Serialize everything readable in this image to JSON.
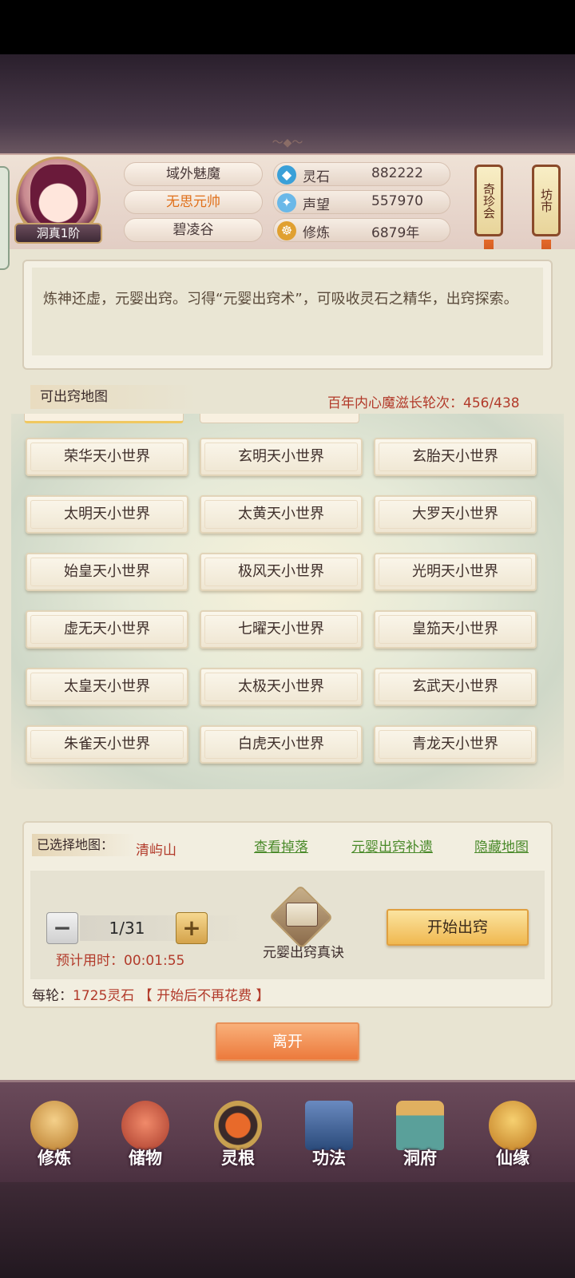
{
  "header": {
    "rank": "洞真1阶",
    "tags": [
      "域外魅魔",
      "无思元帅",
      "碧凌谷"
    ],
    "resources": [
      {
        "icon": "spirit-stone-icon",
        "label": "灵石",
        "value": "882222"
      },
      {
        "icon": "reputation-icon",
        "label": "声望",
        "value": "557970"
      },
      {
        "icon": "cultivation-icon",
        "label": "修炼",
        "value": "6879年"
      }
    ],
    "lanterns": [
      "奇珍会",
      "坊市"
    ]
  },
  "description": "炼神还虚，元婴出窍。习得“元婴出窍术”，可吸收灵石之精华，出窍探索。",
  "maps_section": {
    "title": "可出窍地图",
    "counter": "百年内心魔滋长轮次：456/438",
    "rows": [
      [
        "荣华天小世界",
        "玄明天小世界",
        "玄胎天小世界"
      ],
      [
        "太明天小世界",
        "太黄天小世界",
        "大罗天小世界"
      ],
      [
        "始皇天小世界",
        "极风天小世界",
        "光明天小世界"
      ],
      [
        "虚无天小世界",
        "七曜天小世界",
        "皇笳天小世界"
      ],
      [
        "太皇天小世界",
        "太极天小世界",
        "玄武天小世界"
      ],
      [
        "朱雀天小世界",
        "白虎天小世界",
        "青龙天小世界"
      ]
    ]
  },
  "selection": {
    "label": "已选择地图：",
    "value": "清屿山",
    "links": [
      "查看掉落",
      "元婴出窍补遗",
      "隐藏地图"
    ],
    "stepper": {
      "minus": "−",
      "plus": "+",
      "value": "1/31"
    },
    "eta": "预计用时：00:01:55",
    "item_label": "元婴出窍真诀",
    "start_label": "开始出窍",
    "cost_prefix": "每轮：",
    "cost_value": "1725灵石",
    "cost_note": "【 开始后不再花费 】"
  },
  "leave_label": "离开",
  "nav": [
    {
      "label": "修炼",
      "icon": "meditation-icon",
      "color": "#d8a040"
    },
    {
      "label": "储物",
      "icon": "bag-icon",
      "color": "#d85a4a"
    },
    {
      "label": "灵根",
      "icon": "spirit-root-icon",
      "color": "#c8582a"
    },
    {
      "label": "功法",
      "icon": "scroll-book-icon",
      "color": "#4a6a9a"
    },
    {
      "label": "洞府",
      "icon": "cave-house-icon",
      "color": "#5aa09a"
    },
    {
      "label": "仙缘",
      "icon": "gourd-icon",
      "color": "#e0a03a"
    }
  ],
  "colors": {
    "accent_red": "#b23a2a",
    "link_green": "#4a8a2a",
    "orange_button": "#ec7a3c",
    "gold_button": "#f0b850"
  }
}
